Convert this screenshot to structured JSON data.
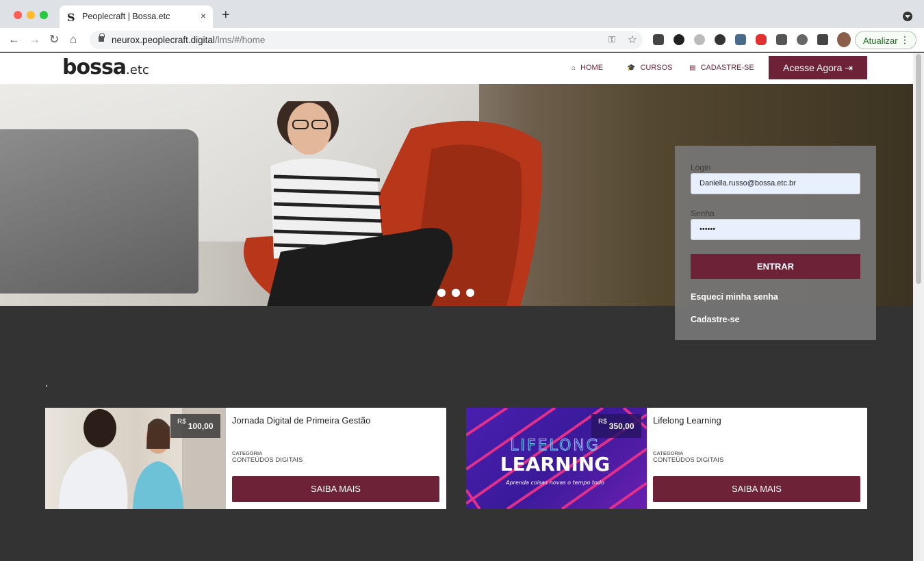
{
  "browser": {
    "tab_title": "Peoplecraft | Bossa.etc",
    "tab_favicon": "S",
    "tab_close": "×",
    "new_tab": "+",
    "url_host": "neurox.peoplecraft.digital",
    "url_path": "/lms/#/home",
    "update_label": "Atualizar",
    "update_menu": "⋮",
    "back": "←",
    "forward": "→",
    "reload": "↻",
    "home": "⌂",
    "star": "☆",
    "key": "⚿",
    "extension_colors": [
      "#444444",
      "#222222",
      "#bbbbbb",
      "#333333",
      "#4a6a8a",
      "#e03030",
      "#555555",
      "#666666",
      "#444444"
    ]
  },
  "header": {
    "logo_main": "bossa",
    "logo_suffix": ".etc",
    "nav": [
      {
        "icon": "home-icon",
        "glyph": "⌂",
        "label": "HOME"
      },
      {
        "icon": "graduation-cap-icon",
        "glyph": "🎓",
        "label": "CURSOS"
      },
      {
        "icon": "register-icon",
        "glyph": "▤",
        "label": "CADASTRE-SE"
      }
    ],
    "cta_label": "Acesse Agora",
    "cta_icon": "⇥"
  },
  "login": {
    "login_label": "Login",
    "login_value": "Daniella.russo@bossa.etc.br",
    "password_label": "Senha",
    "password_value": "••••••",
    "enter_label": "ENTRAR",
    "forgot_label": "Esqueci minha senha",
    "register_label": "Cadastre-se"
  },
  "section": {
    "title": "."
  },
  "courses": [
    {
      "currency": "R$",
      "price": "100,00",
      "title": "Jornada Digital de Primeira Gestão",
      "category_label": "CATEGORIA",
      "category": "CONTEÚDOS DIGITAIS",
      "button": "SAIBA MAIS"
    },
    {
      "currency": "R$",
      "price": "350,00",
      "title": "Lifelong Learning",
      "category_label": "CATEGORIA",
      "category": "CONTEÚDOS DIGITAIS",
      "button": "SAIBA MAIS",
      "image_text_1": "LIFELONG",
      "image_text_2": "LEARNING",
      "image_text_3": "Aprenda coisas novas o tempo todo"
    }
  ],
  "colors": {
    "brand": "#6d2238",
    "page_bg": "#333333"
  }
}
